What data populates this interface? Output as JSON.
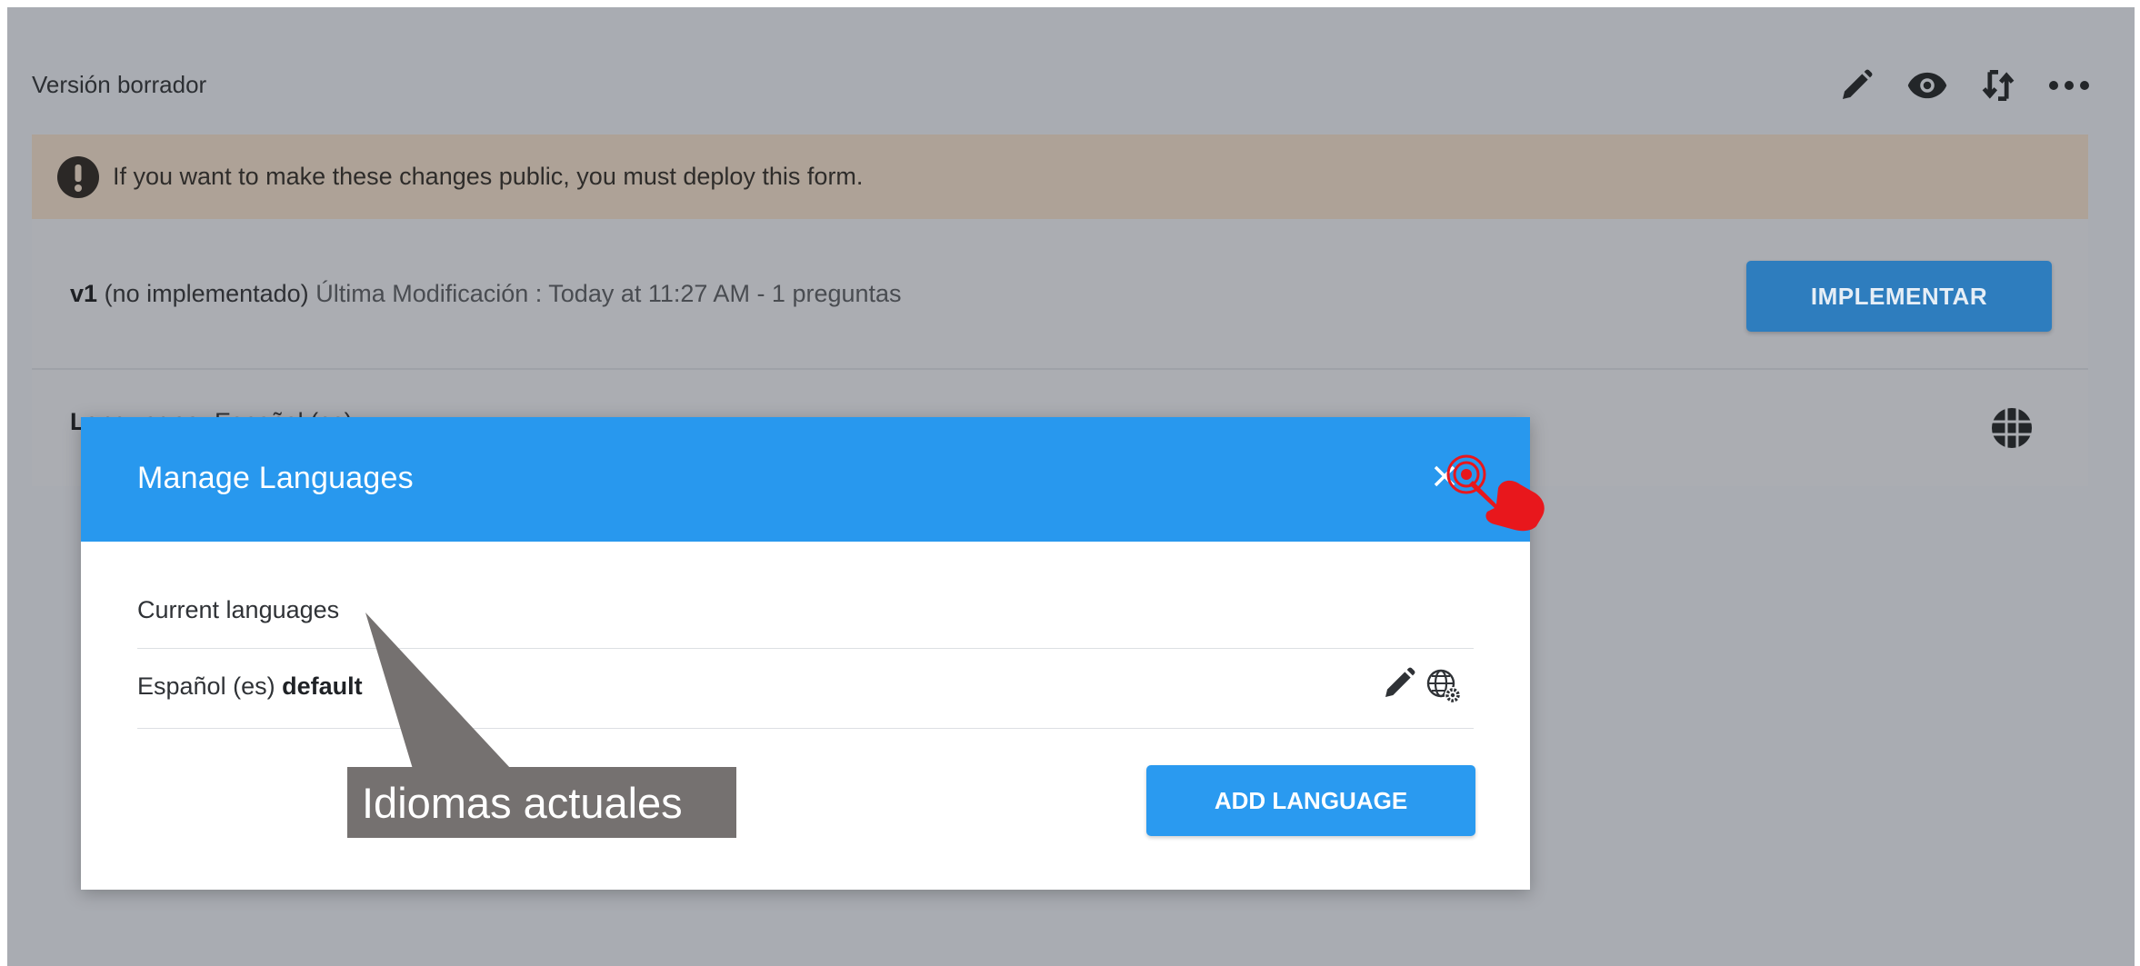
{
  "page": {
    "draft_title": "Versión borrador",
    "actions": [
      {
        "icon": "pencil-icon"
      },
      {
        "icon": "eye-icon"
      },
      {
        "icon": "sync-icon"
      },
      {
        "icon": "more-icon"
      }
    ]
  },
  "alert": {
    "icon": "exclamation-circle-icon",
    "message": "If you want to make these changes public, you must deploy this form."
  },
  "version_row": {
    "version": "v1",
    "status": "(no implementado)",
    "modified": "Última Modificación : Today at 11:27 AM - 1 preguntas",
    "deploy_label": "IMPLEMENTAR"
  },
  "languages_row": {
    "label": "Languages:",
    "value": "Español (es)",
    "icon": "globe-grid-icon"
  },
  "modal": {
    "title": "Manage Languages",
    "close_icon": "close-icon",
    "current_label": "Current languages",
    "languages": [
      {
        "name": "Español (es)",
        "badge": "default"
      }
    ],
    "add_label": "ADD LANGUAGE"
  },
  "annotation": {
    "callout_text": "Idiomas actuales",
    "callout_color": "#757170",
    "cursor_color": "#e8171c"
  },
  "colors": {
    "modal_header": "#2898ee",
    "button_primary": "#2a9af0",
    "overlay": "#a9acb2",
    "alert_bg": "#aea297"
  }
}
